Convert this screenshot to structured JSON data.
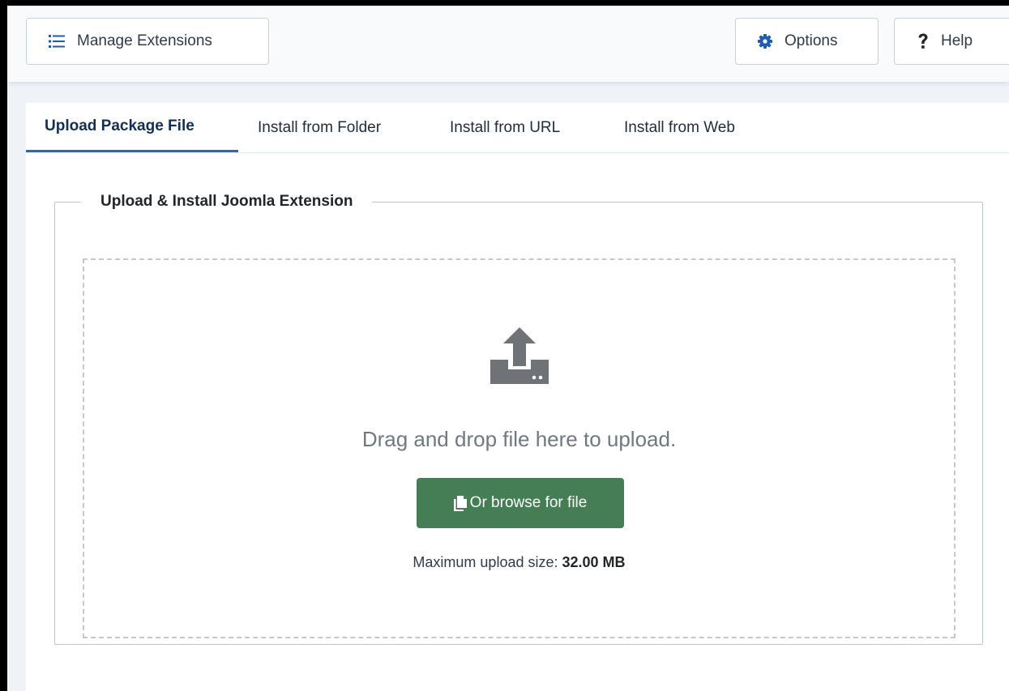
{
  "toolbar": {
    "manage_label": "Manage Extensions",
    "manage_icon": "list-icon",
    "options_label": "Options",
    "options_icon": "gear-icon",
    "help_label": "Help",
    "help_icon": "question-icon"
  },
  "tabs": [
    {
      "label": "Upload Package File",
      "active": true
    },
    {
      "label": "Install from Folder",
      "active": false
    },
    {
      "label": "Install from URL",
      "active": false
    },
    {
      "label": "Install from Web",
      "active": false
    }
  ],
  "upload": {
    "legend": "Upload & Install Joomla Extension",
    "icon": "upload-icon",
    "drag_text": "Drag and drop file here to upload.",
    "browse_label": "Or browse for file",
    "browse_icon": "copy-icon",
    "max_size_label": "Maximum upload size:",
    "max_size_value": "32.00 MB"
  },
  "colors": {
    "accent": "#2a69b8",
    "gear": "#1f5bb0",
    "success": "#457d54",
    "upload_icon": "#6f7378"
  }
}
